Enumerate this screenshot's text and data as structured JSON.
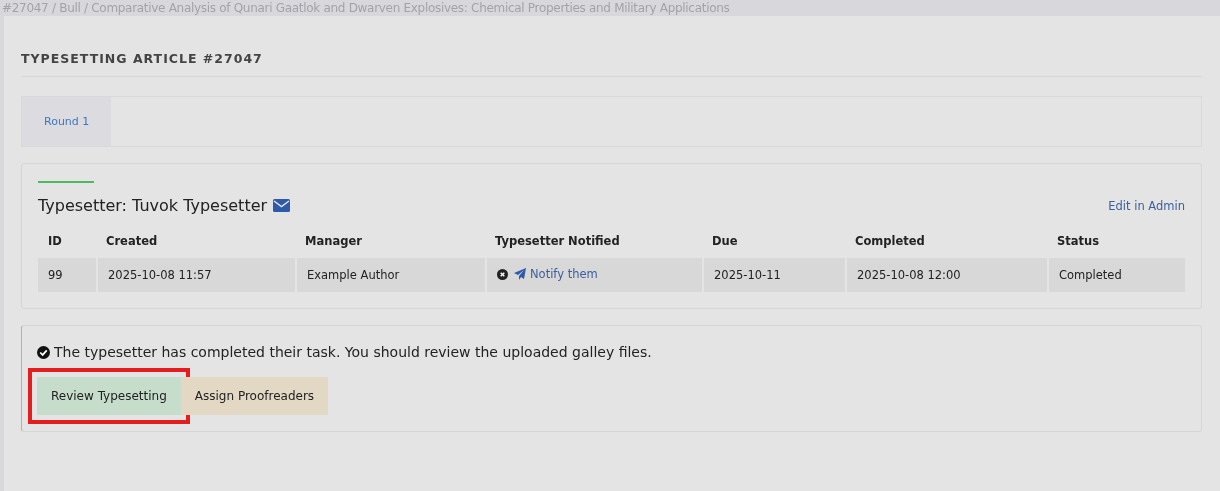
{
  "breadcrumb": "#27047 / Bull / Comparative Analysis of Qunari Gaatlok and Dwarven Explosives: Chemical Properties and Military Applications",
  "title": "TYPESETTING ARTICLE #27047",
  "tabs": [
    {
      "label": "Round 1",
      "selected": true
    }
  ],
  "assignment": {
    "heading": "Typesetter: Tuvok Typesetter",
    "admin_link": "Edit in Admin",
    "columns": [
      "ID",
      "Created",
      "Manager",
      "Typesetter Notified",
      "Due",
      "Completed",
      "Status"
    ],
    "rows": [
      {
        "id": "99",
        "created": "2025-10-08 11:57",
        "manager": "Example Author",
        "notified": false,
        "notify_link": "Notify them",
        "due": "2025-10-11",
        "completed": "2025-10-08 12:00",
        "status": "Completed"
      }
    ]
  },
  "alert": {
    "message": "The typesetter has completed their task. You should review the uploaded galley files.",
    "buttons": [
      {
        "label": "Review Typesetting",
        "kind": "success",
        "highlighted": true
      },
      {
        "label": "Assign Proofreaders",
        "kind": "warning",
        "highlighted": false
      }
    ]
  }
}
